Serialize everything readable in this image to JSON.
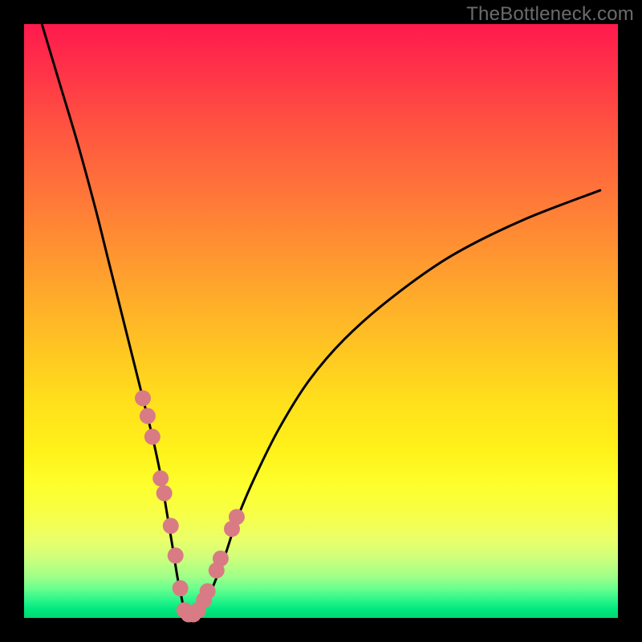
{
  "watermark": "TheBottleneck.com",
  "chart_data": {
    "type": "line",
    "title": "",
    "xlabel": "",
    "ylabel": "",
    "xlim": [
      0,
      100
    ],
    "ylim": [
      0,
      100
    ],
    "series": [
      {
        "name": "bottleneck-curve",
        "x": [
          3,
          6,
          9,
          12,
          14,
          16,
          18,
          20,
          21.5,
          23,
          24,
          25,
          25.8,
          26.5,
          27,
          27.5,
          28.5,
          29.5,
          31,
          32.5,
          34,
          36,
          39,
          43,
          48,
          54,
          62,
          72,
          84,
          97
        ],
        "y": [
          100,
          90,
          80,
          69,
          61,
          53,
          45,
          37,
          31,
          24,
          18,
          12,
          7,
          3.5,
          1.2,
          0.4,
          0.4,
          1.2,
          3.5,
          7,
          11,
          17,
          24,
          32,
          40,
          47,
          54,
          61,
          67,
          72
        ]
      }
    ],
    "markers": {
      "name": "highlight-dots",
      "color": "#d97b84",
      "radius": 10,
      "x": [
        20.0,
        20.8,
        21.6,
        23.0,
        23.6,
        24.7,
        25.5,
        26.3,
        27.0,
        27.7,
        28.5,
        29.3,
        30.3,
        30.9,
        32.4,
        33.1,
        35.0,
        35.8
      ],
      "y": [
        37.0,
        34.0,
        30.5,
        23.5,
        21.0,
        15.5,
        10.5,
        5.0,
        1.3,
        0.6,
        0.6,
        1.3,
        3.0,
        4.5,
        8.0,
        10.0,
        15.0,
        17.0
      ]
    },
    "gradient_stops": [
      {
        "pos": 0.0,
        "color": "#ff1a4d"
      },
      {
        "pos": 0.3,
        "color": "#ff7a38"
      },
      {
        "pos": 0.63,
        "color": "#ffde1c"
      },
      {
        "pos": 0.9,
        "color": "#ccff7d"
      },
      {
        "pos": 1.0,
        "color": "#00d86f"
      }
    ]
  }
}
